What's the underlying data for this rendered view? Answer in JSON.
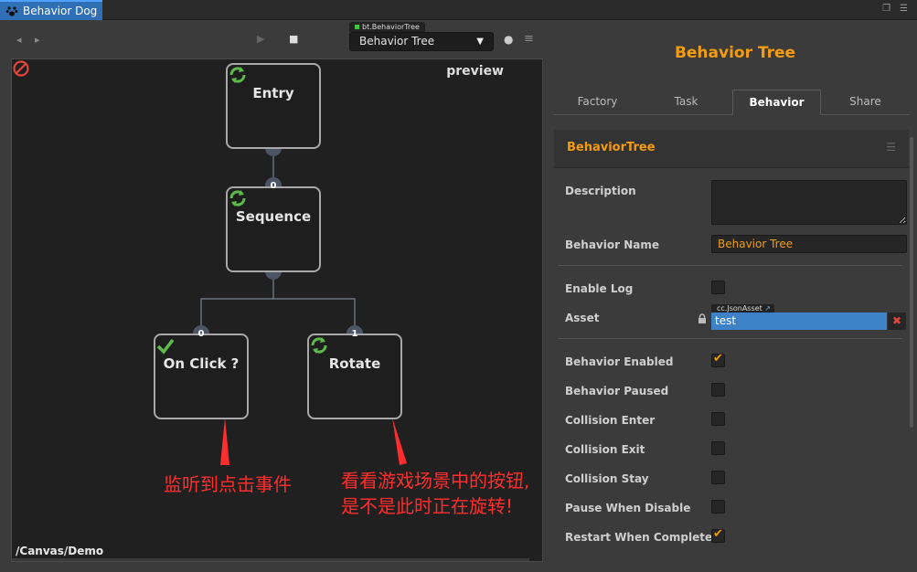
{
  "window": {
    "tab_title": "Behavior Dog"
  },
  "toolbar": {
    "type_tag": "bt.BehaviorTree",
    "tree_select_value": "Behavior Tree"
  },
  "canvas": {
    "preview_label": "preview",
    "path": "/Canvas/Demo",
    "nodes": {
      "entry": {
        "label": "Entry"
      },
      "sequence": {
        "label": "Sequence",
        "index": "0"
      },
      "onclick": {
        "label": "On Click ?",
        "index": "0"
      },
      "rotate": {
        "label": "Rotate",
        "index": "1"
      }
    },
    "annotations": {
      "left": "监听到点击事件",
      "right_line1": "看看游戏场景中的按钮,",
      "right_line2": "是不是此时正在旋转!"
    }
  },
  "panel": {
    "title": "Behavior Tree",
    "tabs": [
      "Factory",
      "Task",
      "Behavior",
      "Share"
    ],
    "active_tab": "Behavior",
    "section_title": "BehaviorTree",
    "props": {
      "description_label": "Description",
      "description_value": "",
      "behavior_name_label": "Behavior Name",
      "behavior_name_value": "Behavior Tree",
      "enable_log_label": "Enable Log",
      "asset_label": "Asset",
      "asset_type": "cc.JsonAsset",
      "asset_value": "test",
      "asset_clear": "✖",
      "behavior_enabled_label": "Behavior Enabled",
      "behavior_paused_label": "Behavior Paused",
      "collision_enter_label": "Collision Enter",
      "collision_exit_label": "Collision Exit",
      "collision_stay_label": "Collision Stay",
      "pause_when_disable_label": "Pause When Disable",
      "restart_when_complete_label": "Restart When Complete"
    },
    "checkboxes": {
      "enable_log": false,
      "behavior_enabled": true,
      "behavior_paused": false,
      "collision_enter": false,
      "collision_exit": false,
      "collision_stay": false,
      "pause_when_disable": false,
      "restart_when_complete": true
    }
  },
  "colors": {
    "accent": "#f39c12",
    "tab_blue": "#2f6fb5",
    "success_green": "#4caf50",
    "stop_red": "#e0463c",
    "annotation_red": "#ff2d2d"
  }
}
